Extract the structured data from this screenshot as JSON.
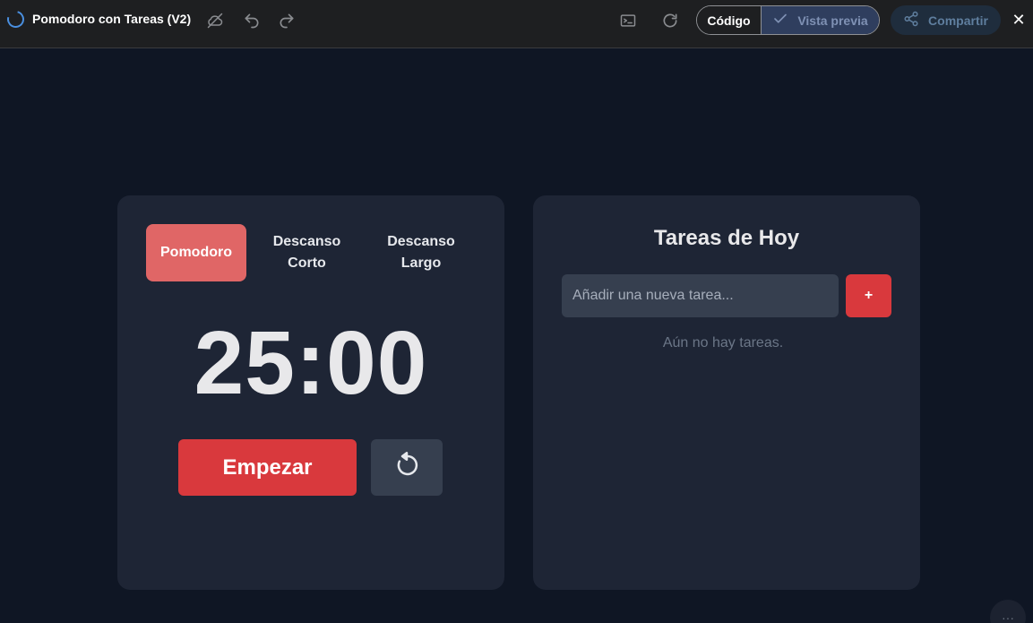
{
  "topbar": {
    "title": "Pomodoro con Tareas (V2)",
    "code_label": "Código",
    "preview_label": "Vista previa",
    "share_label": "Compartir",
    "close_glyph": "✕",
    "icons": [
      "loading-spinner-icon",
      "cloud-icon",
      "undo-icon",
      "redo-icon",
      "terminal-icon",
      "refresh-icon",
      "check-icon",
      "share-icon",
      "close-icon"
    ]
  },
  "timer": {
    "tabs": [
      {
        "label": "Pomodoro",
        "active": true
      },
      {
        "label": "Descanso Corto",
        "active": false
      },
      {
        "label": "Descanso Largo",
        "active": false
      }
    ],
    "display": "25:00",
    "start_label": "Empezar"
  },
  "tasks": {
    "title": "Tareas de Hoy",
    "input_placeholder": "Añadir una nueva tarea...",
    "input_value": "",
    "add_label": "+",
    "empty_message": "Aún no hay tareas."
  },
  "colors": {
    "background": "#0f1624",
    "panel": "#1e2535",
    "accent_red": "#d9393d",
    "active_tab": "#e06666",
    "topbar": "#1e1f21"
  }
}
